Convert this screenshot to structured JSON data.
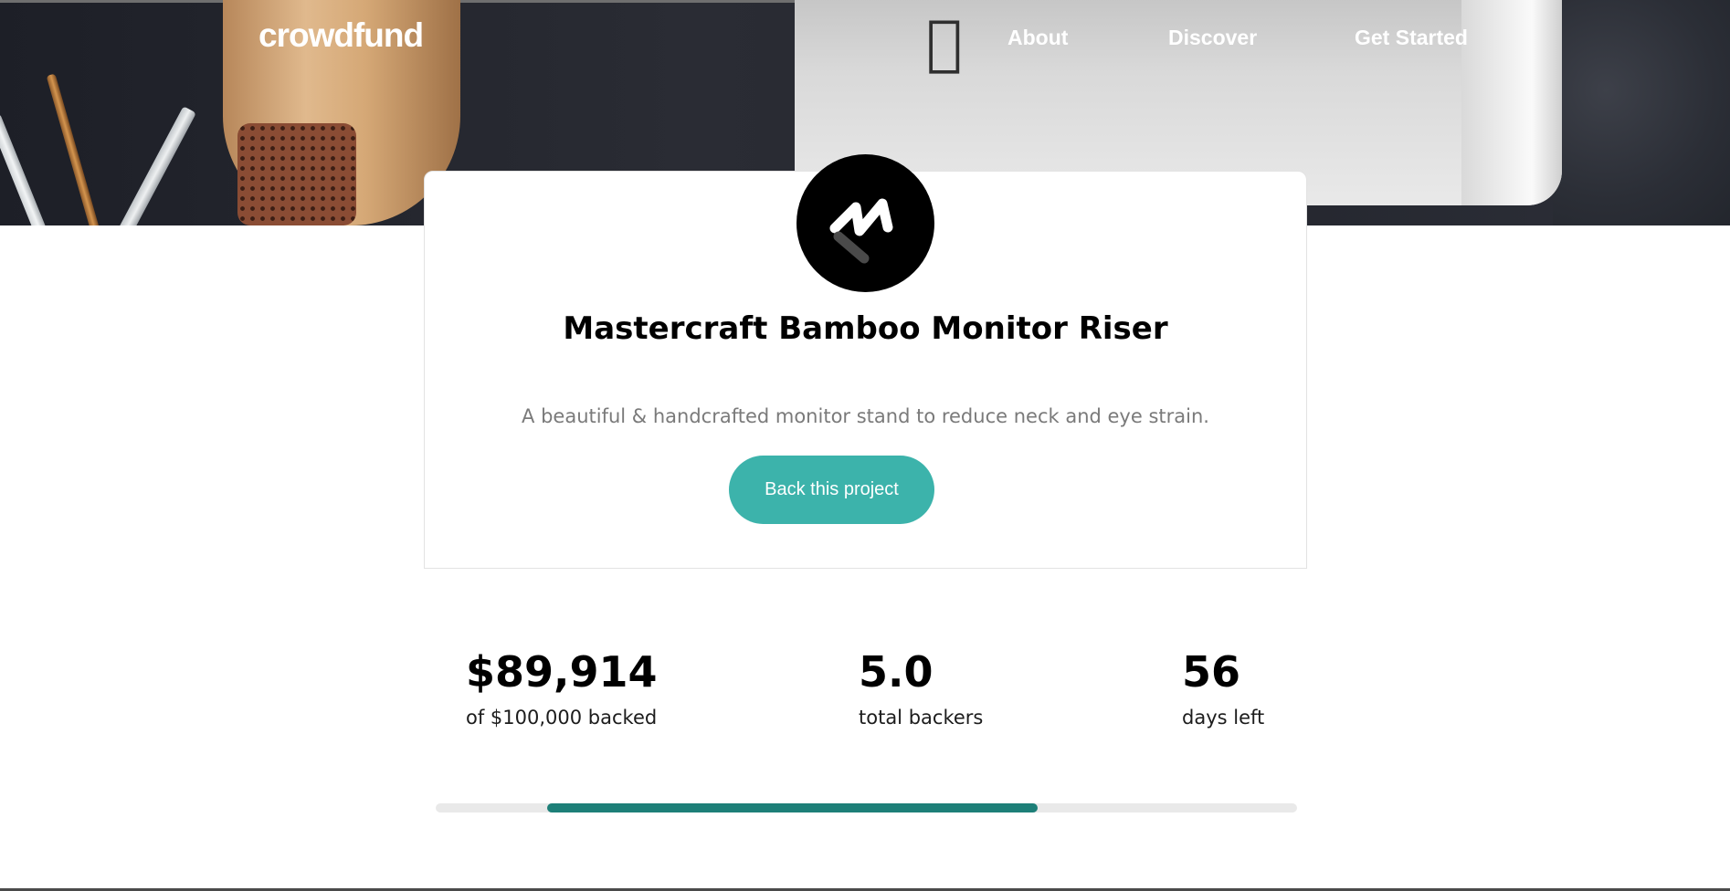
{
  "header": {
    "logo_text": "crowdfund",
    "nav": [
      {
        "label": "About"
      },
      {
        "label": "Discover"
      },
      {
        "label": "Get Started"
      }
    ]
  },
  "project": {
    "title": "Mastercraft Bamboo Monitor Riser",
    "description": "A beautiful & handcrafted monitor stand to reduce neck and eye strain.",
    "back_button_label": "Back this project"
  },
  "stats": [
    {
      "value": "$89,914",
      "label": "of $100,000 backed"
    },
    {
      "value": "5.0",
      "label": "total backers"
    },
    {
      "value": "56",
      "label": "days left"
    }
  ],
  "progress": {
    "start_fraction": 0.129,
    "end_fraction": 0.699
  },
  "colors": {
    "accent": "#3cb3ab",
    "accent_dark": "#1d7f78",
    "track": "#e9e9e9"
  },
  "icons": {
    "project_logo": "mastercraft-logo-icon"
  }
}
